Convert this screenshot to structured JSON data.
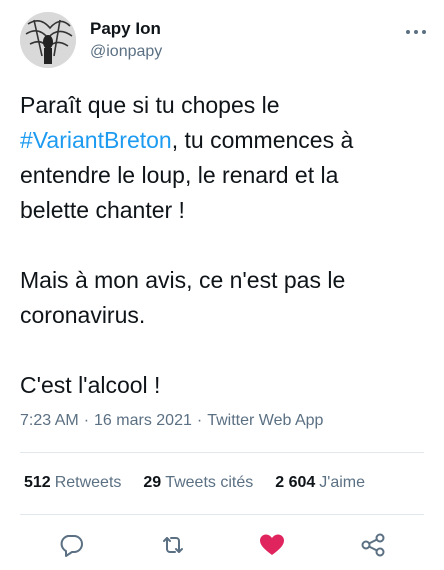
{
  "user": {
    "display_name": "Papy Ion",
    "handle": "@ionpapy",
    "avatar_icon": "avatar-photo"
  },
  "tweet": {
    "line1_before": "Paraît que si tu chopes le",
    "hashtag": "#VariantBreton",
    "line2_after": ", tu commences à",
    "line3": "entendre le loup, le renard et la",
    "line4": "belette chanter !",
    "line5": "Mais à mon avis, ce n'est pas le",
    "line6": "coronavirus.",
    "line7": "C'est l'alcool !"
  },
  "meta": {
    "time": "7:23 AM",
    "separator": "·",
    "date": "16 mars 2021",
    "source": "Twitter Web App"
  },
  "stats": {
    "retweets_count": "512",
    "retweets_label": "Retweets",
    "quotes_count": "29",
    "quotes_label": "Tweets cités",
    "likes_count": "2 604",
    "likes_label": "J'aime"
  },
  "actions": {
    "reply_icon": "reply-icon",
    "retweet_icon": "retweet-icon",
    "like_icon": "heart-icon",
    "share_icon": "share-icon",
    "like_color": "#e0245e",
    "icon_color": "#5b7083"
  },
  "colors": {
    "accent": "#1d9bf0",
    "text": "#0f1419",
    "muted": "#5b7083"
  }
}
